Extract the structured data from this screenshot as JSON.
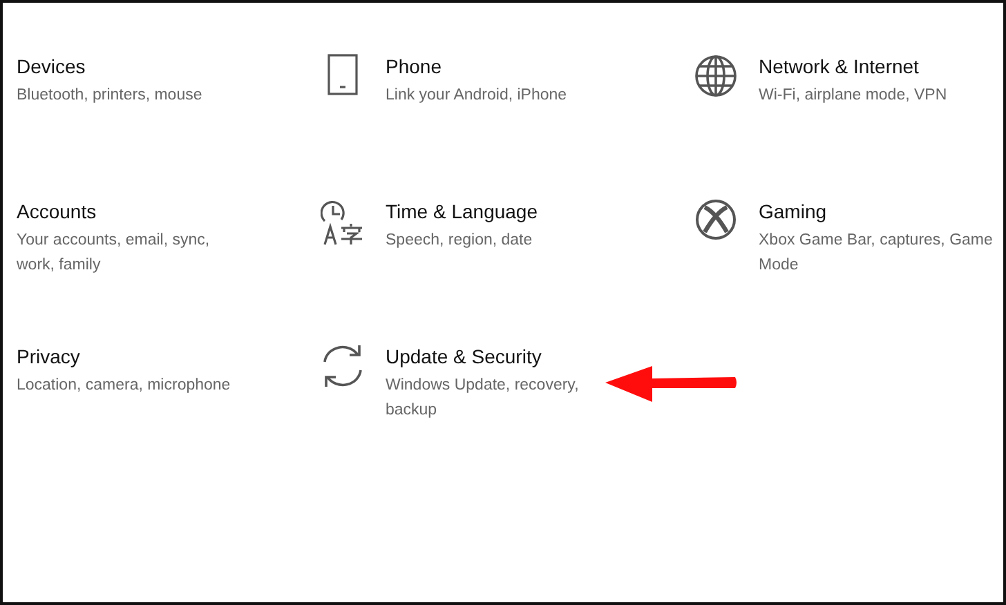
{
  "categories": [
    {
      "title": "Devices",
      "description": "Bluetooth, printers, mouse"
    },
    {
      "title": "Phone",
      "description": "Link your Android, iPhone",
      "kind": "phone"
    },
    {
      "title": "Network & Internet",
      "description": "Wi-Fi, airplane mode, VPN",
      "kind": "network"
    },
    {
      "title": "Accounts",
      "description": "Your accounts, email, sync, work, family"
    },
    {
      "title": "Time & Language",
      "description": "Speech, region, date",
      "kind": "time"
    },
    {
      "title": "Gaming",
      "description": "Xbox Game Bar, captures, Game Mode",
      "kind": "gaming"
    },
    {
      "title": "Privacy",
      "description": "Location, camera, microphone"
    },
    {
      "title": "Update & Security",
      "description": "Windows Update, recovery, backup",
      "kind": "update"
    }
  ]
}
